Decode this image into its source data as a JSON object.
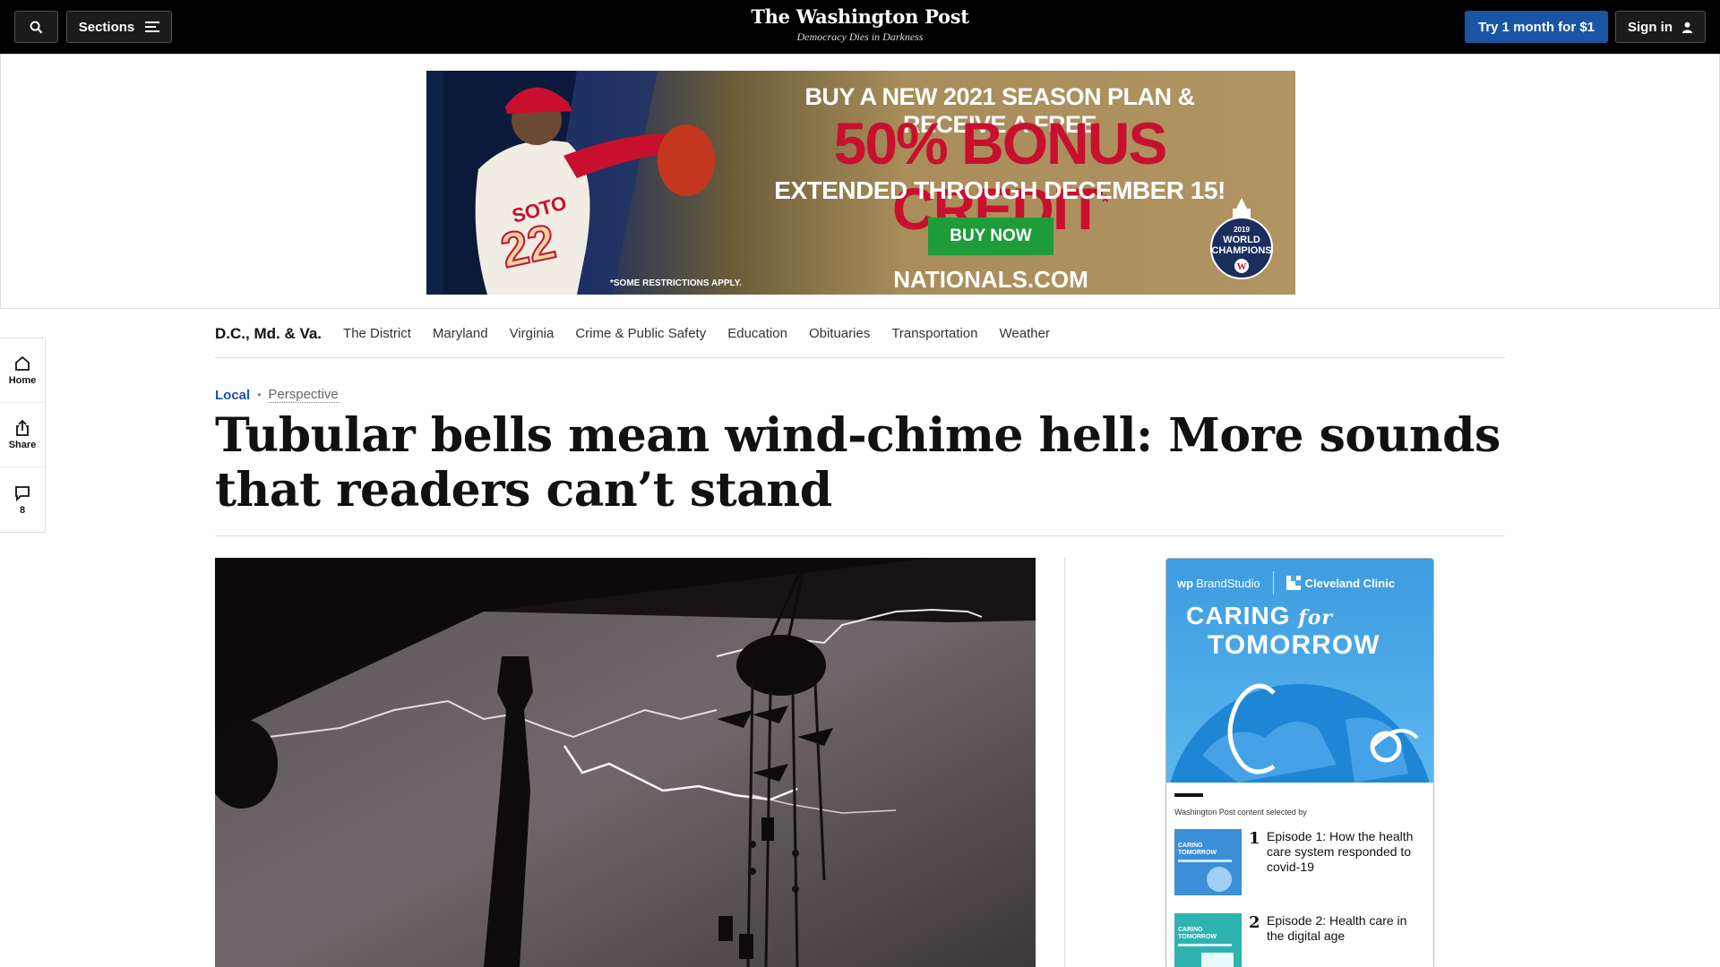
{
  "topbar": {
    "sections_label": "Sections",
    "logo": "The Washington Post",
    "tagline": "Democracy Dies in Darkness",
    "try_label": "Try 1 month for $1",
    "signin_label": "Sign in"
  },
  "ad": {
    "line1": "BUY A NEW 2021 SEASON PLAN & RECEIVE A FREE",
    "line2": "50% BONUS CREDIT",
    "line2_mark": "*",
    "line3": "EXTENDED THROUGH DECEMBER 15!",
    "button": "BUY NOW",
    "restrictions": "*SOME RESTRICTIONS APPLY.",
    "site": "NATIONALS.COM",
    "jersey_name": "SOTO",
    "jersey_number": "22",
    "badge_year": "2019",
    "badge_line1": "WORLD",
    "badge_line2": "CHAMPIONS"
  },
  "rail": {
    "home": "Home",
    "share": "Share",
    "comments": "8"
  },
  "secnav": {
    "title": "D.C., Md. & Va.",
    "links": [
      "The District",
      "Maryland",
      "Virginia",
      "Crime & Public Safety",
      "Education",
      "Obituaries",
      "Transportation",
      "Weather"
    ]
  },
  "article": {
    "section": "Local",
    "label": "Perspective",
    "headline": "Tubular bells mean wind-chime hell: More sounds that readers can’t stand"
  },
  "brandstudio": {
    "wp_label": "BrandStudio",
    "partner": "Cleveland Clinic",
    "caring": "CARING",
    "for": "for",
    "tomorrow": "TOMORROW",
    "selected_by": "Washington Post content selected by",
    "items": [
      {
        "num": "1",
        "title": "Episode 1: How the health care system responded to covid-19"
      },
      {
        "num": "2",
        "title": "Episode 2: Health care in the digital age"
      }
    ],
    "thumb_caring": "CARING",
    "thumb_tomorrow": "TOMORROW"
  }
}
